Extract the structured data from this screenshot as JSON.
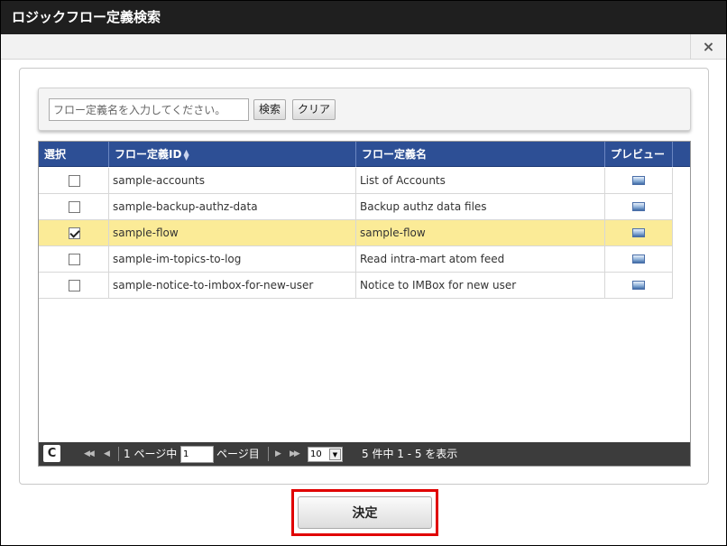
{
  "window": {
    "title": "ロジックフロー定義検索",
    "close_icon": "×"
  },
  "search": {
    "placeholder": "フロー定義名を入力してください。",
    "search_label": "検索",
    "clear_label": "クリア"
  },
  "table": {
    "headers": {
      "select": "選択",
      "flow_id": "フロー定義ID",
      "flow_name": "フロー定義名",
      "preview": "プレビュー"
    },
    "rows": [
      {
        "id": "sample-accounts",
        "name": "List of Accounts",
        "checked": false
      },
      {
        "id": "sample-backup-authz-data",
        "name": "Backup authz data files",
        "checked": false
      },
      {
        "id": "sample-flow",
        "name": "sample-flow",
        "checked": true
      },
      {
        "id": "sample-im-topics-to-log",
        "name": "Read intra-mart atom feed",
        "checked": false
      },
      {
        "id": "sample-notice-to-imbox-for-new-user",
        "name": "Notice to IMBox for new user",
        "checked": false
      }
    ]
  },
  "pager": {
    "refresh_icon": "C",
    "page_prefix": "1 ページ中",
    "page_value": "1",
    "page_suffix": "ページ目",
    "page_size": "10",
    "summary": "5 件中 1 - 5 を表示"
  },
  "footer": {
    "submit_label": "決定"
  },
  "colors": {
    "header_bg": "#2d4f95",
    "selected_row": "#fbeb97",
    "highlight_border": "#e00000"
  }
}
